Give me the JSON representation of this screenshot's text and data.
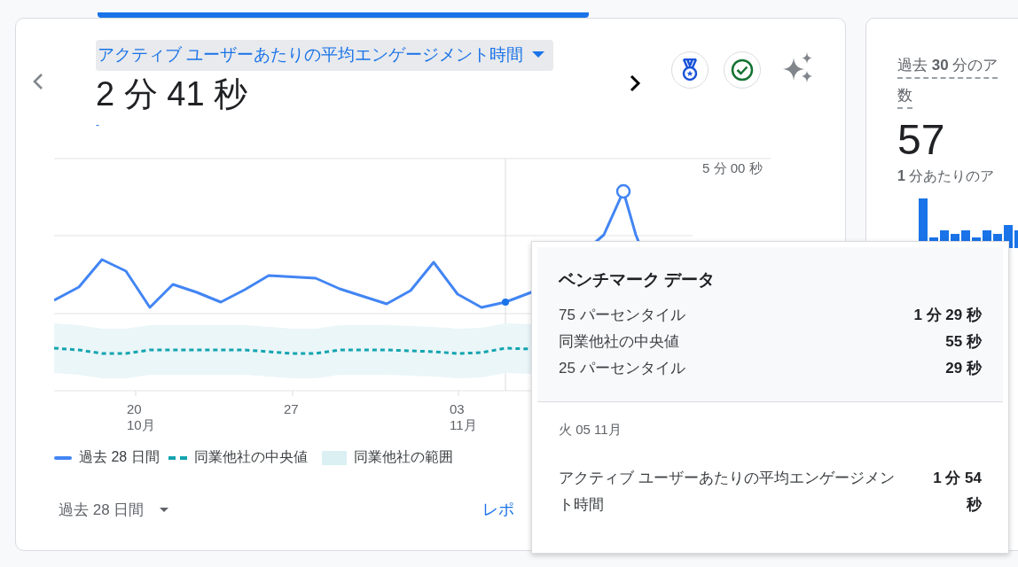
{
  "metric": {
    "title": "アクティブ ユーザーあたりの平均エンゲージメント時間",
    "value": "2 分 41 秒",
    "change": "-"
  },
  "chart": {
    "y_tick": "5 分 00 秒",
    "x_labels": [
      {
        "day": "20",
        "month": "10月"
      },
      {
        "day": "27"
      },
      {
        "day": "03",
        "month": "11月"
      }
    ]
  },
  "legend": [
    {
      "kind": "line",
      "label": "過去 28 日間"
    },
    {
      "kind": "dashed",
      "label": "同業他社の中央値"
    },
    {
      "kind": "band",
      "label": "同業他社の範囲"
    }
  ],
  "footer": {
    "range": "過去 28 日間",
    "link": "レポ"
  },
  "tooltip": {
    "title": "ベンチマーク データ",
    "rows": [
      {
        "label": "75 パーセンタイル",
        "value": "1 分 29 秒"
      },
      {
        "label": "同業他社の中央値",
        "value": "55 秒"
      },
      {
        "label": "25 パーセンタイル",
        "value": "29 秒"
      }
    ],
    "date": "火 05 11月",
    "metric": {
      "label": "アクティブ ユーザーあたりの平均エンゲージメント時間",
      "value": "1 分 54 秒"
    }
  },
  "side_card": {
    "title": "過去 **30** 分のア",
    "title_2": "数",
    "value": "57",
    "subtitle": "**1** 分あたりのア"
  }
}
